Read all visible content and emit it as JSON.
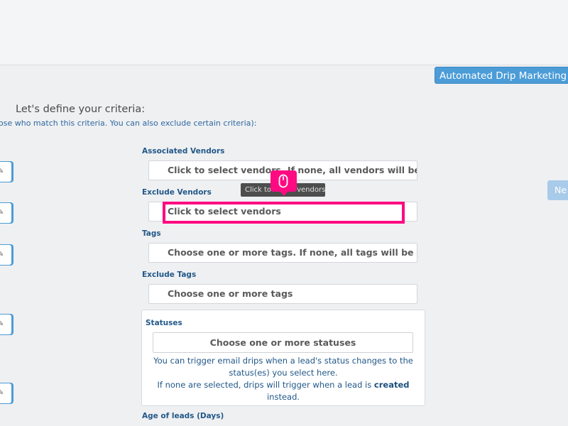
{
  "header": {
    "app_title": "Automated Drip Marketing E"
  },
  "nav": {
    "next_label": "Ne"
  },
  "criteria": {
    "heading": "Let's define your criteria:",
    "subheading": "ose who match this criteria. You can also exclude certain criteria):"
  },
  "fields": {
    "associated_vendors": {
      "label": "Associated Vendors",
      "placeholder": "Click to select vendors. If none, all vendors will be sel"
    },
    "exclude_vendors": {
      "label": "Exclude Vendors",
      "placeholder": "Click to select vendors",
      "tooltip": "Click to select vendors"
    },
    "tags": {
      "label": "Tags",
      "placeholder": "Choose one or more tags. If none, all tags will be sele"
    },
    "exclude_tags": {
      "label": "Exclude Tags",
      "placeholder": "Choose one or more tags"
    },
    "statuses": {
      "label": "Statuses",
      "placeholder": "Choose one or more statuses",
      "help_line1": "You can trigger email drips when a lead's status changes to the status(es) you select here.",
      "help_line2_pre": "If none are selected, drips will trigger when a lead is ",
      "help_line2_bold": "created",
      "help_line2_post": " instead."
    },
    "age_of_leads": {
      "label": "Age of leads (Days)"
    }
  },
  "icons": {
    "edit": "pencil-icon",
    "mouse": "mouse-icon"
  },
  "colors": {
    "accent": "#4b9cd7",
    "highlight": "#ff0a82",
    "label": "#225888"
  }
}
